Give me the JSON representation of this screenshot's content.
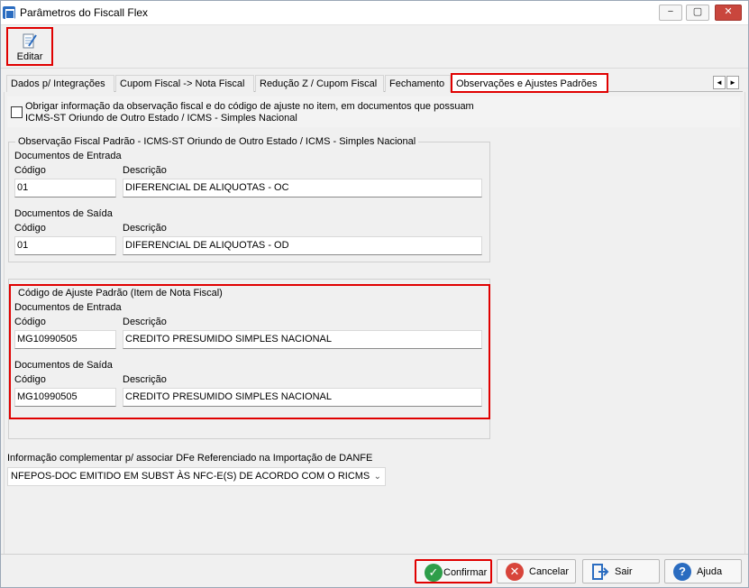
{
  "window": {
    "title": "Parâmetros do Fiscall Flex",
    "min": "−",
    "max": "▢",
    "close": "✕"
  },
  "toolbar": {
    "edit_label": "Editar"
  },
  "tabs": [
    {
      "label": "Dados p/ Integrações"
    },
    {
      "label": "Cupom Fiscal -> Nota Fiscal"
    },
    {
      "label": "Redução Z / Cupom Fiscal"
    },
    {
      "label": "Fechamento"
    },
    {
      "label": "Observações e Ajustes Padrões"
    }
  ],
  "tab_scroll": {
    "left": "◄",
    "right": "►"
  },
  "obrigar": {
    "text": "Obrigar informação da observação fiscal e do código de ajuste no item, em documentos que possuam ICMS-ST Oriundo de Outro Estado / ICMS - Simples Nacional",
    "checked": false
  },
  "obs_fiscal": {
    "title": "Observação Fiscal Padrão - ICMS-ST Oriundo de Outro Estado / ICMS - Simples Nacional",
    "entrada": {
      "section": "Documentos de Entrada",
      "codigo_label": "Código",
      "descricao_label": "Descrição",
      "codigo": "01",
      "descricao": "DIFERENCIAL DE ALIQUOTAS - OC"
    },
    "saida": {
      "section": "Documentos de Saída",
      "codigo_label": "Código",
      "descricao_label": "Descrição",
      "codigo": "01",
      "descricao": "DIFERENCIAL DE ALIQUOTAS - OD"
    }
  },
  "ajuste": {
    "title": "Código de Ajuste Padrão (Item de Nota Fiscal)",
    "entrada": {
      "section": "Documentos de Entrada",
      "codigo_label": "Código",
      "descricao_label": "Descrição",
      "codigo": "MG10990505",
      "descricao": "CREDITO PRESUMIDO SIMPLES NACIONAL"
    },
    "saida": {
      "section": "Documentos de Saída",
      "codigo_label": "Código",
      "descricao_label": "Descrição",
      "codigo": "MG10990505",
      "descricao": "CREDITO PRESUMIDO SIMPLES NACIONAL"
    }
  },
  "info_comp": {
    "label": "Informação complementar p/ associar DFe Referenciado na Importação de DANFE",
    "value": "NFEPOS-DOC EMITIDO EM SUBST ÀS NFC-E(S) DE ACORDO COM O RICMS",
    "arrow": "⌄"
  },
  "buttons": {
    "confirmar": "Confirmar",
    "cancelar": "Cancelar",
    "sair": "Sair",
    "ajuda": "Ajuda",
    "confirm_icon": "✓",
    "cancel_icon": "✕",
    "help_icon": "?"
  },
  "colors": {
    "highlight": "#e00000",
    "confirm": "#2e9e4a",
    "cancel": "#d8453b",
    "help": "#2a6cc0",
    "exit": "#2a6cc0"
  }
}
